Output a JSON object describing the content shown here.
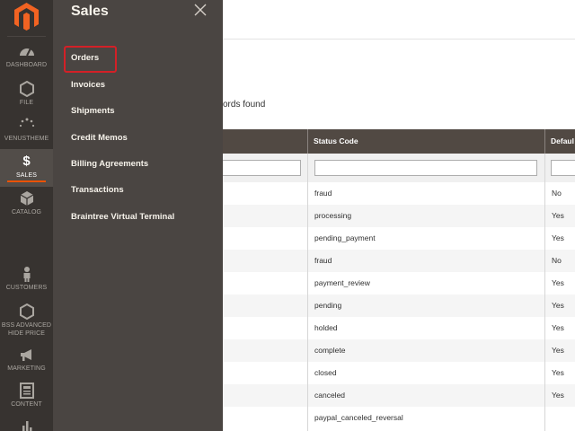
{
  "leftnav": {
    "items": [
      {
        "label": "DASHBOARD",
        "icon": "dashboard-icon"
      },
      {
        "label": "FILE",
        "icon": "hexagon-icon"
      },
      {
        "label": "VENUSTHEME",
        "icon": "dots-spinner-icon"
      },
      {
        "label": "SALES",
        "icon": "dollar-icon"
      },
      {
        "label": "CATALOG",
        "icon": "cube-icon"
      },
      {
        "label": "CUSTOMERS",
        "icon": "person-icon"
      },
      {
        "label": "BSS ADVANCED",
        "label2": "HIDE PRICE",
        "icon": "hexagon-icon"
      },
      {
        "label": "MARKETING",
        "icon": "megaphone-icon"
      },
      {
        "label": "CONTENT",
        "icon": "layout-icon"
      }
    ],
    "accent": "#eb5202"
  },
  "sales_panel": {
    "title": "Sales",
    "items": [
      "Orders",
      "Invoices",
      "Shipments",
      "Credit Memos",
      "Billing Agreements",
      "Transactions",
      "Braintree Virtual Terminal"
    ],
    "highlight_color": "#d32027"
  },
  "main": {
    "records_text": "ords found",
    "columns": [
      "Status Code",
      "Defaul"
    ],
    "rows": [
      {
        "status_code": "fraud",
        "default": "No"
      },
      {
        "status_code": "processing",
        "default": "Yes"
      },
      {
        "status_code": "pending_payment",
        "default": "Yes"
      },
      {
        "status_code": "fraud",
        "default": "No"
      },
      {
        "status_code": "payment_review",
        "default": "Yes"
      },
      {
        "status_code": "pending",
        "default": "Yes"
      },
      {
        "status_code": "holded",
        "default": "Yes"
      },
      {
        "status_code": "complete",
        "default": "Yes"
      },
      {
        "status_code": "closed",
        "default": "Yes"
      },
      {
        "status_code": "canceled",
        "default": "Yes"
      },
      {
        "status_code": "paypal_canceled_reversal",
        "default": ""
      }
    ]
  }
}
